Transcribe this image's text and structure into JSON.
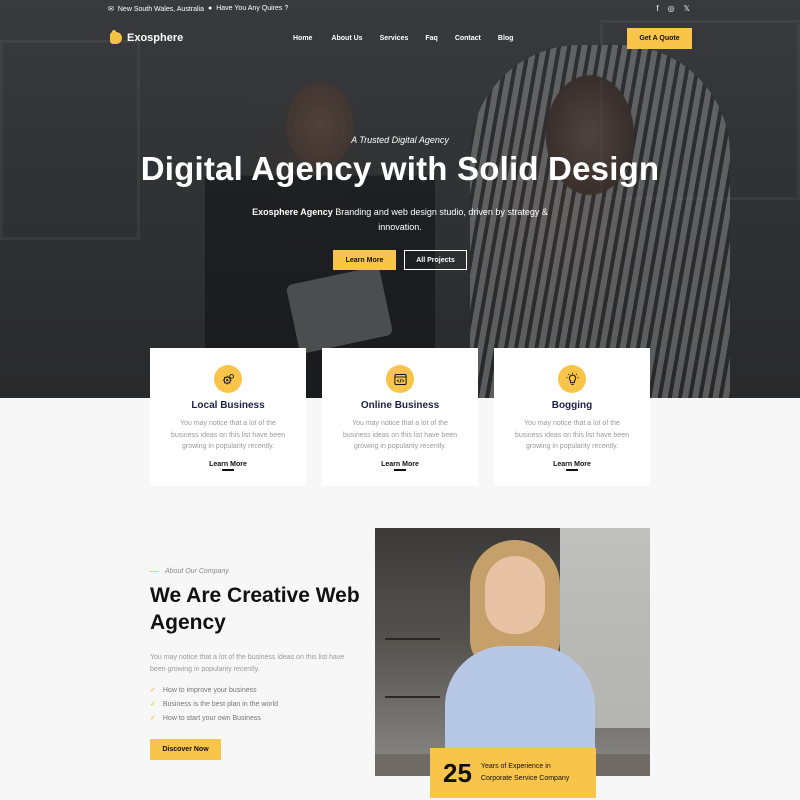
{
  "topbar": {
    "location": "New South Wales, Australia",
    "question": "Have You Any Quires ?",
    "location_icon": "envelope-icon",
    "question_icon": "map-pin-icon",
    "social": [
      "facebook-icon",
      "instagram-icon",
      "x-icon"
    ]
  },
  "brand": {
    "name": "Exosphere",
    "accent": "#f8c44a"
  },
  "nav": {
    "items": [
      "Home",
      "About Us",
      "Services",
      "Faq",
      "Contact",
      "Blog"
    ],
    "cta": "Get A Quote"
  },
  "hero": {
    "eyebrow": "A Trusted Digital Agency",
    "title": "Digital Agency with Solid Design",
    "subtitle_strong": "Exosphere Agency",
    "subtitle_rest": " Branding and web design studio, driven by strategy & innovation.",
    "primary_btn": "Learn More",
    "secondary_btn": "All Projects"
  },
  "services": [
    {
      "title": "Local Business",
      "icon": "gears-icon",
      "text": "You may notice that a lot of the business ideas on this list have been growing in popularity recently.",
      "link": "Learn More"
    },
    {
      "title": "Online Business",
      "icon": "code-window-icon",
      "text": "You may notice that a lot of the business ideas on this list have been growing in popularity recently.",
      "link": "Learn More"
    },
    {
      "title": "Bogging",
      "icon": "lightbulb-icon",
      "text": "You may notice that a lot of the business ideas on this list have been growing in popularity recently.",
      "link": "Learn More"
    }
  ],
  "about": {
    "eyebrow": "About Our Company",
    "title": "We Are Creative Web Agency",
    "desc": "You may notice that a lot of the business ideas on this list have been growing in popularity recently.",
    "checks": [
      "How to improve your business",
      "Business is the best plan in the world",
      "How to start your own Business"
    ],
    "button": "Discover Now"
  },
  "experience": {
    "years": "25",
    "label_line1": "Years of Experience in",
    "label_line2": "Corporate Service Company"
  }
}
